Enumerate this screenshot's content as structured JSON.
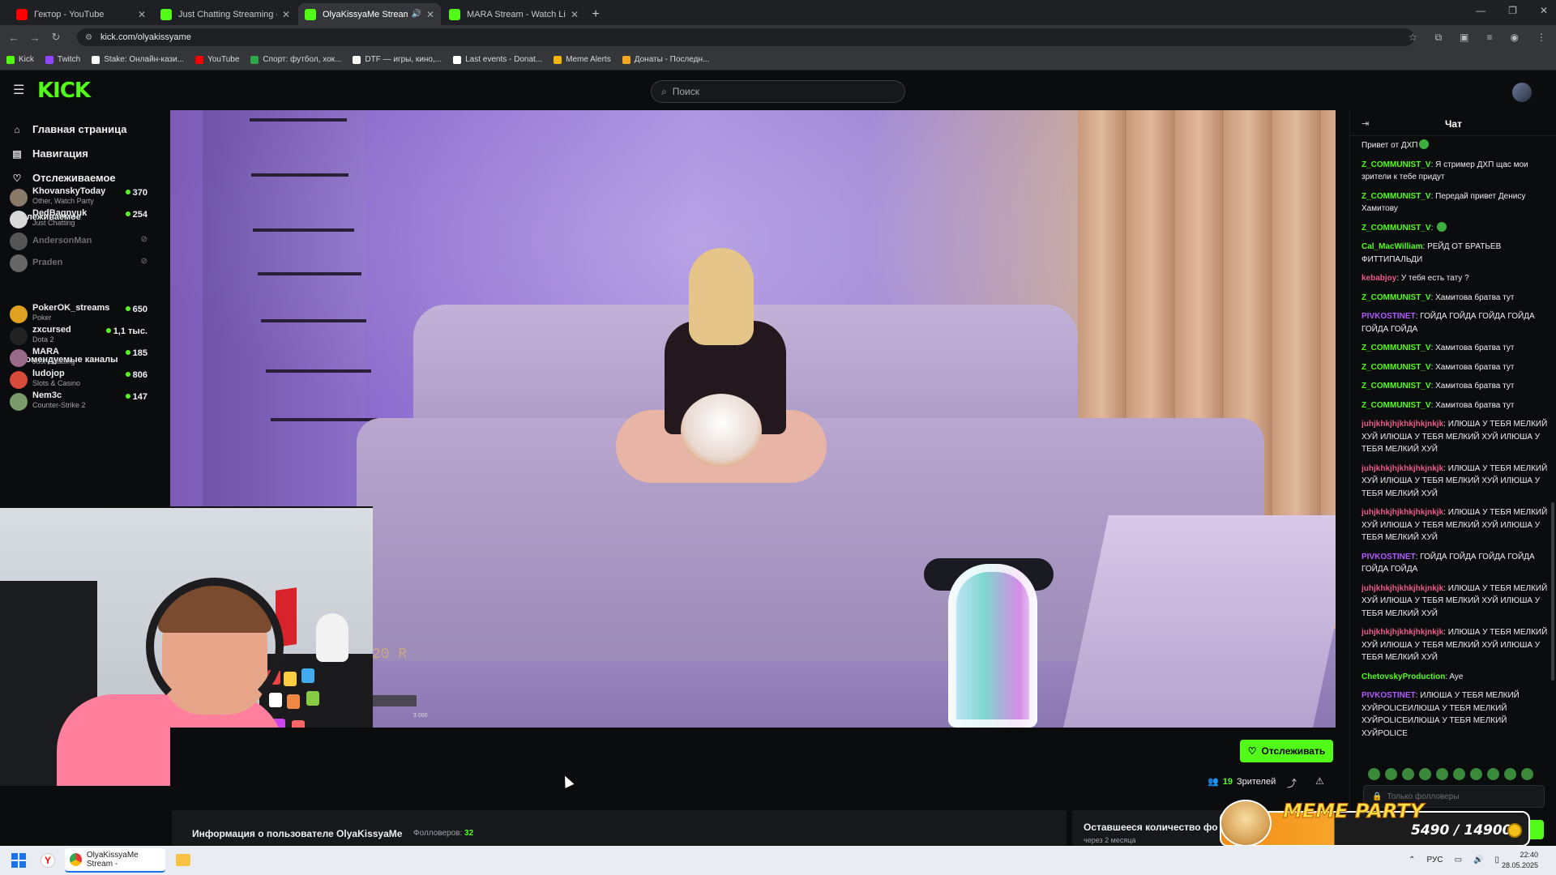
{
  "browser": {
    "tabs": [
      {
        "title": "Гектор - YouTube",
        "icon": "youtube-icon",
        "color": "#ff0000",
        "active": false
      },
      {
        "title": "Just Chatting Streaming - Live S",
        "icon": "kick-icon",
        "color": "#53fc18",
        "active": false
      },
      {
        "title": "OlyaKissyaMe Stream - Wa",
        "icon": "kick-icon",
        "color": "#53fc18",
        "active": true
      },
      {
        "title": "MARA Stream - Watch Live on",
        "icon": "kick-icon",
        "color": "#53fc18",
        "active": false
      }
    ],
    "url": "kick.com/olyakissyame",
    "bookmarks": [
      {
        "label": "Kick",
        "color": "#53fc18"
      },
      {
        "label": "Twitch",
        "color": "#9146ff"
      },
      {
        "label": "Stake: Онлайн-кази...",
        "color": "#ffffff"
      },
      {
        "label": "YouTube",
        "color": "#ff0000"
      },
      {
        "label": "Спорт: футбол, хок...",
        "color": "#2aa84a"
      },
      {
        "label": "DTF — игры, кино,...",
        "color": "#ffffff"
      },
      {
        "label": "Last events - Donat...",
        "color": "#ffffff"
      },
      {
        "label": "Meme Alerts",
        "color": "#f5b800"
      },
      {
        "label": "Донаты - Последн...",
        "color": "#f5a623"
      }
    ]
  },
  "kick": {
    "logo": "KICK",
    "search_placeholder": "Поиск",
    "nav": [
      {
        "label": "Главная страница",
        "icon": "home-icon"
      },
      {
        "label": "Навигация",
        "icon": "browse-icon"
      },
      {
        "label": "Отслеживаемое",
        "icon": "heart-icon"
      }
    ],
    "followed_title": "Отслеживаемое",
    "followed": [
      {
        "name": "KhovanskyToday",
        "category": "Other, Watch Party",
        "viewers": "370",
        "live": true,
        "avatar": "#8a7a6a"
      },
      {
        "name": "DedBagnyuk",
        "category": "Just Chatting",
        "viewers": "254",
        "live": true,
        "avatar": "#d8d8d8"
      },
      {
        "name": "AndersonMan",
        "category": "",
        "viewers": "",
        "live": false,
        "avatar": "#555555"
      },
      {
        "name": "Praden",
        "category": "",
        "viewers": "",
        "live": false,
        "avatar": "#666666"
      }
    ],
    "recommended_title": "Рекомендуемые каналы",
    "recommended": [
      {
        "name": "PokerOK_streams",
        "category": "Poker",
        "viewers": "650",
        "avatar": "#e0a020"
      },
      {
        "name": "zxcursed",
        "category": "Dota 2",
        "viewers": "1,1 тыс.",
        "avatar": "#222222"
      },
      {
        "name": "MARA",
        "category": "Just Chatting",
        "viewers": "185",
        "avatar": "#9a6a8a"
      },
      {
        "name": "ludojop",
        "category": "Slots & Casino",
        "viewers": "806",
        "avatar": "#d84a3a"
      },
      {
        "name": "Nem3c",
        "category": "Counter-Strike 2",
        "viewers": "147",
        "avatar": "#7a9a6a"
      }
    ]
  },
  "video": {
    "overlay_text": "20 R",
    "overlay_small": "3 000"
  },
  "stream_info": {
    "follow_label": "Отслеживать",
    "viewers_count": "19",
    "viewers_label": "Зрителей",
    "about_title": "Информация о пользователе OlyaKissyaMe",
    "followers_label": "Фолловеров:",
    "followers_count": "32",
    "remaining_title": "Оставшееся количество фо",
    "remaining_sub": "через 2 месяца"
  },
  "chat": {
    "title": "Чат",
    "input_placeholder": "Только фолловеры",
    "messages": [
      {
        "user": "",
        "text": "Привет от ДХП",
        "color": "#efeff1",
        "emote": true
      },
      {
        "user": "Z_COMMUNIST_V",
        "text": "Я стример ДХП щас мои зрители к тебе придут",
        "color": "#53fc18"
      },
      {
        "user": "Z_COMMUNIST_V",
        "text": "Передай привет Денису Хамитову",
        "color": "#53fc18"
      },
      {
        "user": "Z_COMMUNIST_V",
        "text": "",
        "color": "#53fc18",
        "emote": true
      },
      {
        "user": "Cal_MacWilliam",
        "text": "РЕЙД ОТ БРАТЬЕВ ФИТТИПАЛЬДИ",
        "color": "#53fc18"
      },
      {
        "user": "kebabjoy",
        "text": "У тебя есть тату ?",
        "color": "#e85a8a"
      },
      {
        "user": "Z_COMMUNIST_V",
        "text": "Хамитова братва тут",
        "color": "#53fc18"
      },
      {
        "user": "PIVKOSTINET",
        "text": "ГОЙДА ГОЙДА ГОЙДА ГОЙДА ГОЙДА ГОЙДА",
        "color": "#b05cff"
      },
      {
        "user": "Z_COMMUNIST_V",
        "text": "Хамитова братва тут",
        "color": "#53fc18"
      },
      {
        "user": "Z_COMMUNIST_V",
        "text": "Хамитова братва тут",
        "color": "#53fc18"
      },
      {
        "user": "Z_COMMUNIST_V",
        "text": "Хамитова братва тут",
        "color": "#53fc18"
      },
      {
        "user": "Z_COMMUNIST_V",
        "text": "Хамитова братва тут",
        "color": "#53fc18"
      },
      {
        "user": "juhjkhkjhjkhkjhkjnkjk",
        "text": "ИЛЮША У ТЕБЯ МЕЛКИЙ ХУЙ ИЛЮША У ТЕБЯ МЕЛКИЙ ХУЙ ИЛЮША У ТЕБЯ МЕЛКИЙ ХУЙ",
        "color": "#e85a8a"
      },
      {
        "user": "juhjkhkjhjkhkjhkjnkjk",
        "text": "ИЛЮША У ТЕБЯ МЕЛКИЙ ХУЙ ИЛЮША У ТЕБЯ МЕЛКИЙ ХУЙ ИЛЮША У ТЕБЯ МЕЛКИЙ ХУЙ",
        "color": "#e85a8a"
      },
      {
        "user": "juhjkhkjhjkhkjhkjnkjk",
        "text": "ИЛЮША У ТЕБЯ МЕЛКИЙ ХУЙ ИЛЮША У ТЕБЯ МЕЛКИЙ ХУЙ ИЛЮША У ТЕБЯ МЕЛКИЙ ХУЙ",
        "color": "#e85a8a"
      },
      {
        "user": "PIVKOSTINET",
        "text": "ГОЙДА ГОЙДА ГОЙДА ГОЙДА ГОЙДА ГОЙДА",
        "color": "#b05cff"
      },
      {
        "user": "juhjkhkjhjkhkjhkjnkjk",
        "text": "ИЛЮША У ТЕБЯ МЕЛКИЙ ХУЙ ИЛЮША У ТЕБЯ МЕЛКИЙ ХУЙ ИЛЮША У ТЕБЯ МЕЛКИЙ ХУЙ",
        "color": "#e85a8a"
      },
      {
        "user": "juhjkhkjhjkhkjhkjnkjk",
        "text": "ИЛЮША У ТЕБЯ МЕЛКИЙ ХУЙ ИЛЮША У ТЕБЯ МЕЛКИЙ ХУЙ ИЛЮША У ТЕБЯ МЕЛКИЙ ХУЙ",
        "color": "#e85a8a"
      },
      {
        "user": "ChetovskyProduction",
        "text": "Aye",
        "color": "#53fc18"
      },
      {
        "user": "PIVKOSTINET",
        "text": "ИЛЮША У ТЕБЯ МЕЛКИЙ ХУЙPOLICEИЛЮША У ТЕБЯ МЕЛКИЙ ХУЙPOLICEИЛЮША У ТЕБЯ МЕЛКИЙ ХУЙPOLICE",
        "color": "#b05cff"
      }
    ]
  },
  "widget": {
    "title": "MEME PARTY",
    "value": "5490 / 14900",
    "progress": 0.368
  },
  "taskbar": {
    "chrome_label": "OlyaKissyaMe Stream - ",
    "lang": "РУС",
    "time": "22:40",
    "date": "28.05.2025"
  }
}
